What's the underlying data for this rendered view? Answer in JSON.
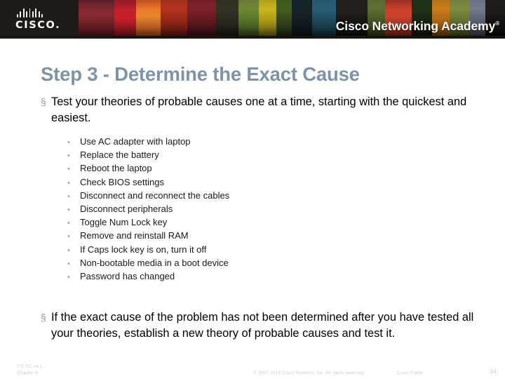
{
  "banner": {
    "logo_name": "cisco-logo",
    "logo_wordmark": "CISCO",
    "logo_dot": ".",
    "academy_text": "Cisco Networking Academy",
    "academy_trademark": "®"
  },
  "slide": {
    "title": "Step 3 - Determine the Exact Cause",
    "title_color": "#7e93a8",
    "bullets": [
      {
        "marker": "§",
        "text": "Test your theories of probable causes one at a time, starting with the quickest and easiest.",
        "subitems": [
          "Use AC adapter with laptop",
          "Replace the battery",
          "Reboot the laptop",
          "Check BIOS settings",
          "Disconnect and reconnect the cables",
          "Disconnect peripherals",
          "Toggle Num Lock key",
          "Remove and reinstall RAM",
          "If Caps lock key is on, turn it off",
          "Non-bootable media in a boot device",
          "Password has changed"
        ]
      },
      {
        "marker": "§",
        "text": "If the exact cause of the problem has not been determined after you have tested all your theories, establish a new theory of probable causes and test it.",
        "subitems": []
      }
    ],
    "sub_marker": "•"
  },
  "footer": {
    "course": "ITE PC v4.1",
    "chapter": "Chapter 6",
    "copyright": "© 2007-2010 Cisco Systems, Inc. All rights reserved.",
    "classification": "Cisco Public",
    "page_number": "34"
  }
}
